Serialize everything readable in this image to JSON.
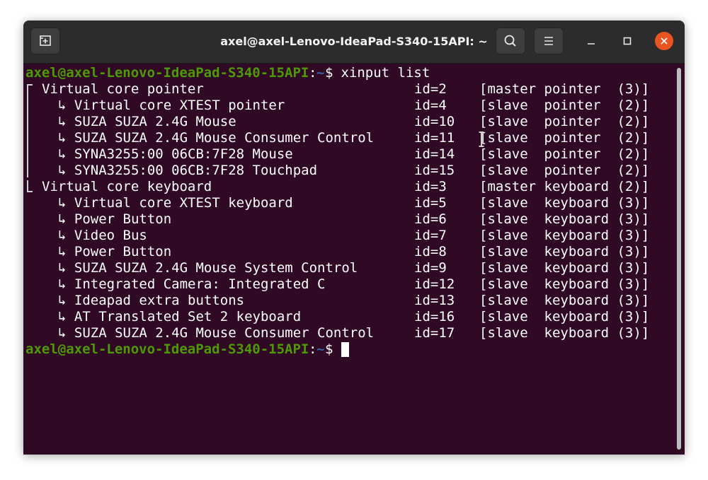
{
  "window": {
    "title": "axel@axel-Lenovo-IdeaPad-S340-15API: ~"
  },
  "icons": {
    "new_tab": "new-tab-icon",
    "search": "search-icon",
    "menu": "hamburger-menu-icon",
    "minimize": "minimize-icon",
    "maximize": "maximize-icon",
    "close": "close-icon"
  },
  "colors": {
    "terminal_bg": "#300a24",
    "prompt_user": "#4e9a06",
    "prompt_path": "#3465a4",
    "close_button": "#e95420"
  },
  "terminal": {
    "prompt": {
      "user_host": "axel@axel-Lenovo-IdeaPad-S340-15API",
      "colon": ":",
      "path": "~",
      "dollar": "$"
    },
    "command": " xinput list",
    "devices": [
      {
        "name": "Virtual core pointer",
        "id": "id=2",
        "type": "[master pointer  (3)]"
      },
      {
        "name": "↳ Virtual core XTEST pointer",
        "id": "id=4",
        "type": "[slave  pointer  (2)]"
      },
      {
        "name": "↳ SUZA SUZA 2.4G Mouse",
        "id": "id=10",
        "type": "[slave  pointer  (2)]"
      },
      {
        "name": "↳ SUZA SUZA 2.4G Mouse Consumer Control",
        "id": "id=11",
        "type": "[slave  pointer  (2)]"
      },
      {
        "name": "↳ SYNA3255:00 06CB:7F28 Mouse",
        "id": "id=14",
        "type": "[slave  pointer  (2)]"
      },
      {
        "name": "↳ SYNA3255:00 06CB:7F28 Touchpad",
        "id": "id=15",
        "type": "[slave  pointer  (2)]"
      },
      {
        "name": "Virtual core keyboard",
        "id": "id=3",
        "type": "[master keyboard (2)]"
      },
      {
        "name": "↳ Virtual core XTEST keyboard",
        "id": "id=5",
        "type": "[slave  keyboard (3)]"
      },
      {
        "name": "↳ Power Button",
        "id": "id=6",
        "type": "[slave  keyboard (3)]"
      },
      {
        "name": "↳ Video Bus",
        "id": "id=7",
        "type": "[slave  keyboard (3)]"
      },
      {
        "name": "↳ Power Button",
        "id": "id=8",
        "type": "[slave  keyboard (3)]"
      },
      {
        "name": "↳ SUZA SUZA 2.4G Mouse System Control",
        "id": "id=9",
        "type": "[slave  keyboard (3)]"
      },
      {
        "name": "↳ Integrated Camera: Integrated C",
        "id": "id=12",
        "type": "[slave  keyboard (3)]"
      },
      {
        "name": "↳ Ideapad extra buttons",
        "id": "id=13",
        "type": "[slave  keyboard (3)]"
      },
      {
        "name": "↳ AT Translated Set 2 keyboard",
        "id": "id=16",
        "type": "[slave  keyboard (3)]"
      },
      {
        "name": "↳ SUZA SUZA 2.4G Mouse Consumer Control",
        "id": "id=17",
        "type": "[slave  keyboard (3)]"
      }
    ]
  }
}
